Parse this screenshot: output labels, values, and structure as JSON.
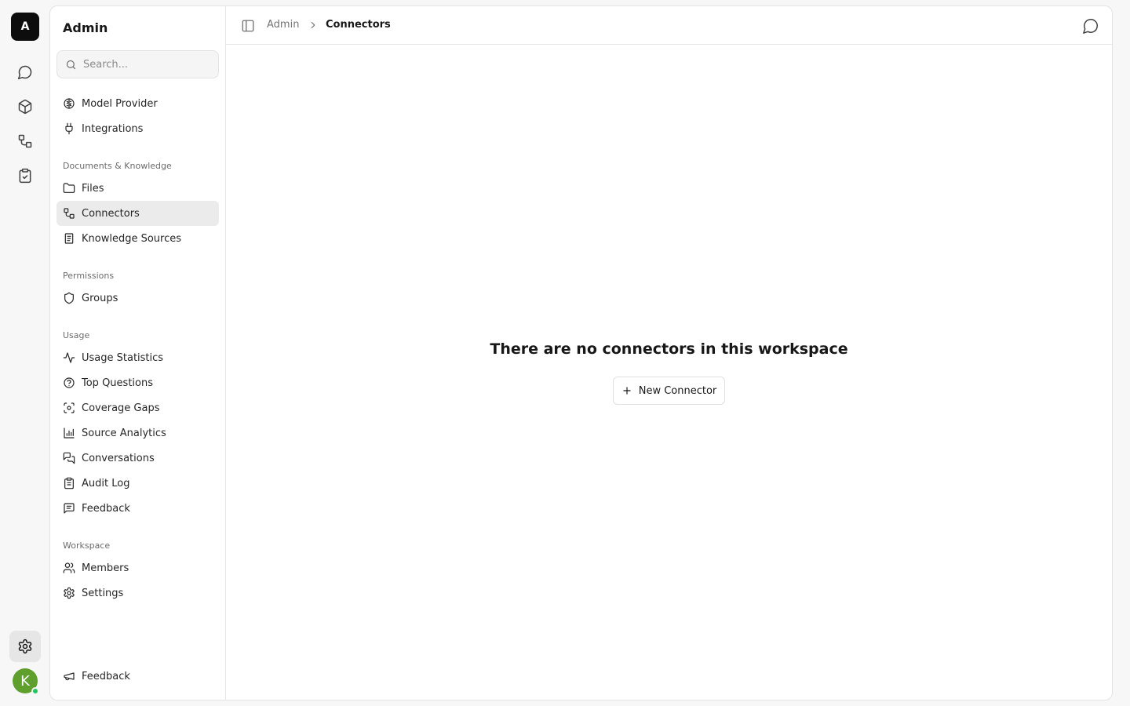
{
  "rail": {
    "logo_letter": "A",
    "avatar_letter": "K"
  },
  "sidebar": {
    "title": "Admin",
    "search_placeholder": "Search...",
    "top_items": [
      {
        "label": "Model Provider",
        "icon": "brain-icon"
      },
      {
        "label": "Integrations",
        "icon": "plug-icon"
      }
    ],
    "sections": [
      {
        "label": "Documents & Knowledge",
        "items": [
          {
            "label": "Files",
            "icon": "folder-icon"
          },
          {
            "label": "Connectors",
            "icon": "connectors-icon",
            "active": true
          },
          {
            "label": "Knowledge Sources",
            "icon": "book-icon"
          }
        ]
      },
      {
        "label": "Permissions",
        "items": [
          {
            "label": "Groups",
            "icon": "shield-icon"
          }
        ]
      },
      {
        "label": "Usage",
        "items": [
          {
            "label": "Usage Statistics",
            "icon": "activity-icon"
          },
          {
            "label": "Top Questions",
            "icon": "help-circle-icon"
          },
          {
            "label": "Coverage Gaps",
            "icon": "scan-icon"
          },
          {
            "label": "Source Analytics",
            "icon": "bar-chart-icon"
          },
          {
            "label": "Conversations",
            "icon": "messages-icon"
          },
          {
            "label": "Audit Log",
            "icon": "clipboard-list-icon"
          },
          {
            "label": "Feedback",
            "icon": "message-square-text-icon"
          }
        ]
      },
      {
        "label": "Workspace",
        "items": [
          {
            "label": "Members",
            "icon": "users-icon"
          },
          {
            "label": "Settings",
            "icon": "settings-icon"
          }
        ]
      }
    ],
    "footer_item": {
      "label": "Feedback",
      "icon": "megaphone-icon"
    }
  },
  "topbar": {
    "breadcrumb_root": "Admin",
    "breadcrumb_current": "Connectors"
  },
  "main": {
    "empty_title": "There are no connectors in this workspace",
    "new_button_label": "New Connector"
  },
  "colors": {
    "accent_dark": "#0d0d0d",
    "active_bg": "#ebebeb",
    "avatar_bg": "#5e9f2d",
    "status_online": "#22c55e"
  }
}
